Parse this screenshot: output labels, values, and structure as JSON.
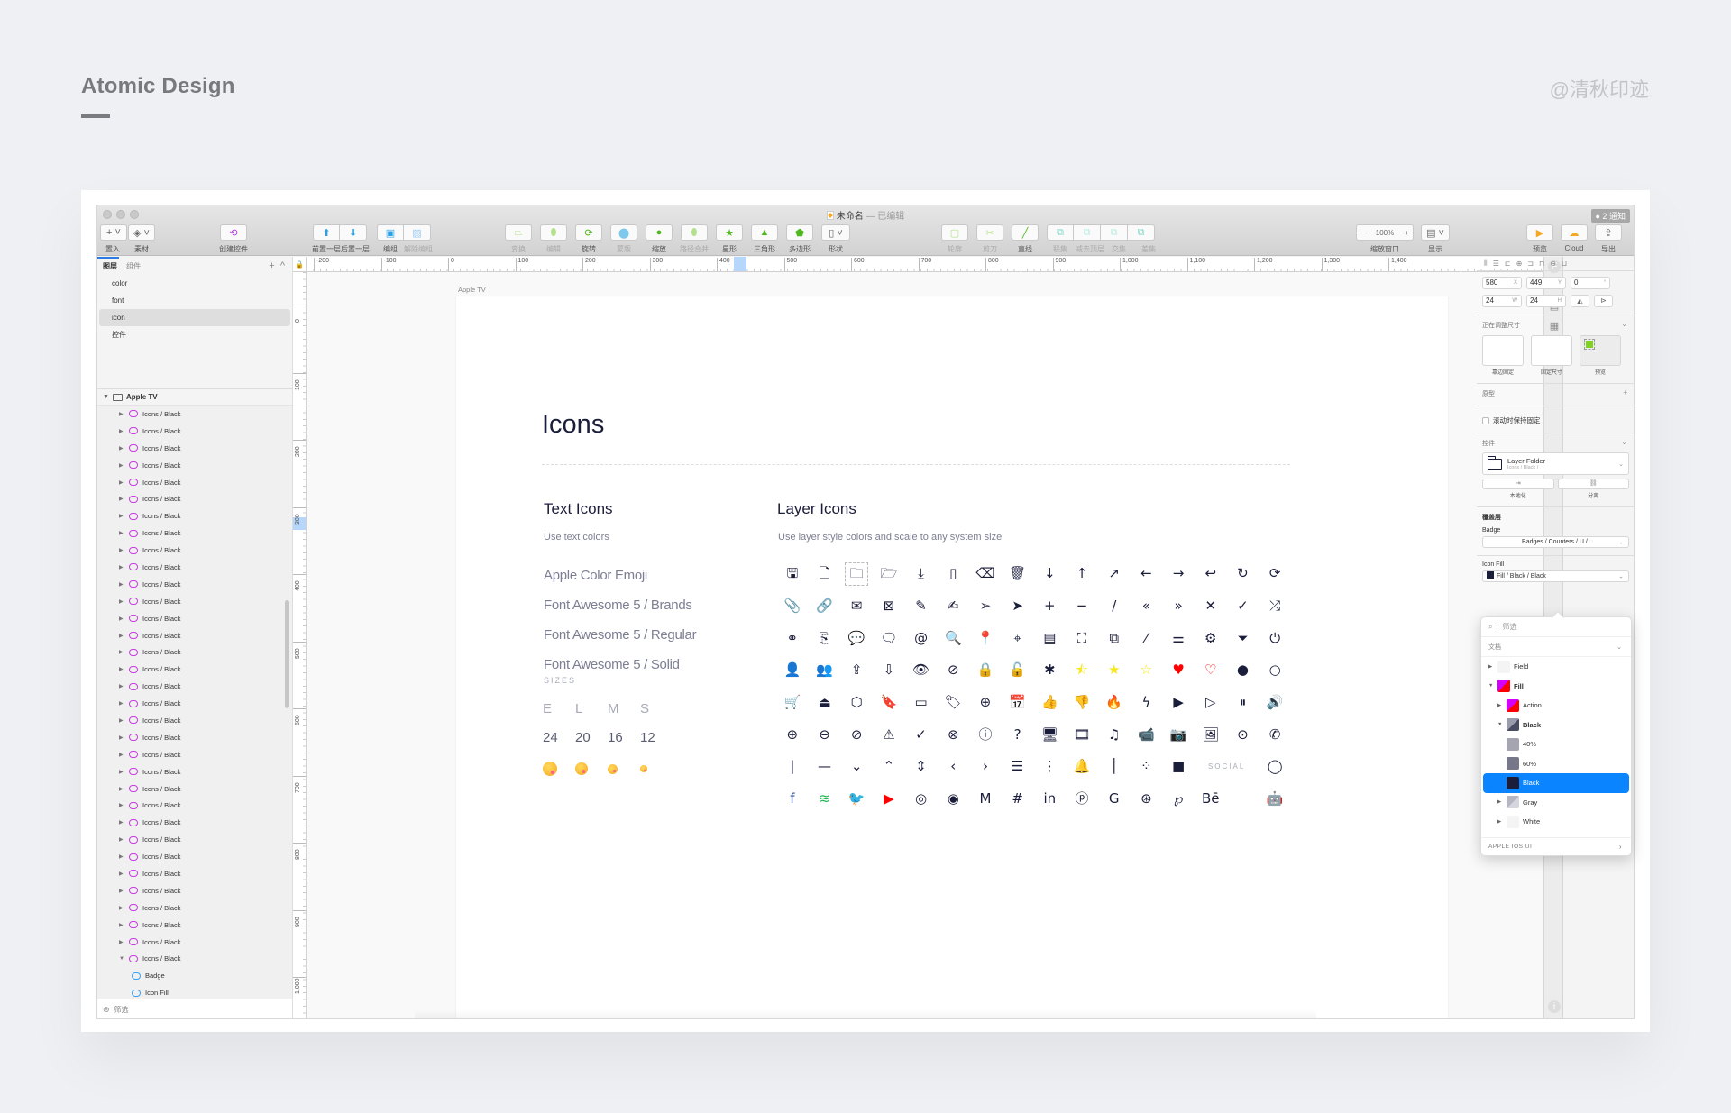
{
  "page": {
    "heading": "Atomic Design",
    "watermark": "@清秋印迹"
  },
  "window": {
    "title": "未命名",
    "title_status": "— 已编辑",
    "notification_badge": "● 2 通知"
  },
  "toolbar": {
    "insert": {
      "label": "置入",
      "icon": "plus-icon"
    },
    "assets": {
      "label": "素材",
      "icon": "layers-icon"
    },
    "create_symbol": {
      "label": "创建控件",
      "icon": "sync-icon"
    },
    "forward": {
      "label": "前置一层"
    },
    "backward": {
      "label": "后置一层"
    },
    "group": {
      "label": "编组"
    },
    "ungroup": {
      "label": "解除编组"
    },
    "transform": {
      "label": "变换"
    },
    "edit": {
      "label": "编辑"
    },
    "rotate": {
      "label": "旋转"
    },
    "mask": {
      "label": "蒙版"
    },
    "scale": {
      "label": "缩放"
    },
    "flatten": {
      "label": "路径合并"
    },
    "star": {
      "label": "星形"
    },
    "triangle": {
      "label": "三角形"
    },
    "polygon": {
      "label": "多边形"
    },
    "shape": {
      "label": "形状"
    },
    "outline": {
      "label": "轮廓"
    },
    "scissors": {
      "label": "剪刀"
    },
    "line": {
      "label": "直线"
    },
    "union": {
      "label": "联集"
    },
    "subtract": {
      "label": "减去顶层"
    },
    "intersect": {
      "label": "交集"
    },
    "difference": {
      "label": "差集"
    },
    "zoom": {
      "label": "缩放窗口",
      "value": "100%",
      "minus": "−",
      "plus": "+"
    },
    "view": {
      "label": "显示"
    },
    "preview": {
      "label": "预览"
    },
    "cloud": {
      "label": "Cloud"
    },
    "export": {
      "label": "导出"
    }
  },
  "left_panel": {
    "tabs": [
      "图层",
      "组件"
    ],
    "add_label": "+",
    "collapse_label": "^",
    "pages": [
      {
        "name": "color",
        "selected": false
      },
      {
        "name": "font",
        "selected": false
      },
      {
        "name": "icon",
        "selected": true
      },
      {
        "name": "控件",
        "selected": false
      }
    ],
    "artboard": "Apple TV",
    "layers": [
      "Icons / Black",
      "Icons / Black",
      "Icons / Black",
      "Icons / Black",
      "Icons / Black",
      "Icons / Black",
      "Icons / Black",
      "Icons / Black",
      "Icons / Black",
      "Icons / Black",
      "Icons / Black",
      "Icons / Black",
      "Icons / Black",
      "Icons / Black",
      "Icons / Black",
      "Icons / Black",
      "Icons / Black",
      "Icons / Black",
      "Icons / Black",
      "Icons / Black",
      "Icons / Black",
      "Icons / Black",
      "Icons / Black",
      "Icons / Black",
      "Icons / Black",
      "Icons / Black",
      "Icons / Black",
      "Icons / Black",
      "Icons / Black",
      "Icons / Black",
      "Icons / Black",
      "Icons / Black",
      "Icons / Black"
    ],
    "expanded_layer": "Icons / Black",
    "children": [
      "Badge",
      "Icon Fill"
    ],
    "selected_layer": "Icons / Black",
    "filter_label": "筛选"
  },
  "rulers": {
    "horizontal": [
      "-200",
      "-100",
      "0",
      "100",
      "200",
      "300",
      "400",
      "500",
      "600",
      "700",
      "800",
      "900",
      "1,000",
      "1,100",
      "1,200",
      "1,300",
      "1,400"
    ],
    "vertical": [
      "0",
      "100",
      "200",
      "300",
      "400",
      "500",
      "600",
      "700",
      "800",
      "900",
      "1,000"
    ]
  },
  "canvas": {
    "artboard_label": "Apple TV",
    "title": "Icons",
    "text_icons": {
      "title": "Text Icons",
      "subtitle": "Use text colors",
      "fonts": [
        "Apple Color Emoji",
        "Font Awesome 5 / Brands",
        "Font Awesome 5 / Regular",
        "Font Awesome 5 / Solid"
      ],
      "sizes_label": "SIZES",
      "size_letters": [
        "E",
        "L",
        "M",
        "S"
      ],
      "size_values": [
        "24",
        "20",
        "16",
        "12"
      ]
    },
    "layer_icons": {
      "title": "Layer Icons",
      "subtitle": "Use layer style colors and scale to any system size",
      "social_label": "SOCIAL",
      "icons": [
        {
          "name": "save",
          "glyph": "🖫"
        },
        {
          "name": "file",
          "glyph": "🗋"
        },
        {
          "name": "folder",
          "glyph": "🗀",
          "selected": true
        },
        {
          "name": "folder-open",
          "glyph": "🗁"
        },
        {
          "name": "download",
          "glyph": "⤓"
        },
        {
          "name": "file-zip",
          "glyph": "▯"
        },
        {
          "name": "backspace",
          "glyph": "⌫"
        },
        {
          "name": "trash",
          "glyph": "🗑"
        },
        {
          "name": "arrow-down",
          "glyph": "↓"
        },
        {
          "name": "arrow-up",
          "glyph": "↑"
        },
        {
          "name": "arrow-up-right",
          "glyph": "↗"
        },
        {
          "name": "arrow-left",
          "glyph": "←"
        },
        {
          "name": "arrow-right",
          "glyph": "→"
        },
        {
          "name": "undo",
          "glyph": "↩"
        },
        {
          "name": "redo",
          "glyph": "↻"
        },
        {
          "name": "sync",
          "glyph": "⟳"
        },
        {
          "name": "paperclip",
          "glyph": "📎"
        },
        {
          "name": "link",
          "glyph": "🔗"
        },
        {
          "name": "mail",
          "glyph": "✉"
        },
        {
          "name": "mail-open",
          "glyph": "⊠"
        },
        {
          "name": "pen",
          "glyph": "✎"
        },
        {
          "name": "edit",
          "glyph": "✍"
        },
        {
          "name": "send",
          "glyph": "➢"
        },
        {
          "name": "navigation",
          "glyph": "➤"
        },
        {
          "name": "plus",
          "glyph": "+"
        },
        {
          "name": "minus",
          "glyph": "−"
        },
        {
          "name": "slash",
          "glyph": "/"
        },
        {
          "name": "chevrons-left",
          "glyph": "«"
        },
        {
          "name": "chevrons-right",
          "glyph": "»"
        },
        {
          "name": "close",
          "glyph": "✕"
        },
        {
          "name": "check",
          "glyph": "✓"
        },
        {
          "name": "shuffle",
          "glyph": "⤮"
        },
        {
          "name": "link-alt",
          "glyph": "⚭"
        },
        {
          "name": "copy",
          "glyph": "⎘"
        },
        {
          "name": "comment",
          "glyph": "💬"
        },
        {
          "name": "comments",
          "glyph": "🗨"
        },
        {
          "name": "at",
          "glyph": "@"
        },
        {
          "name": "search",
          "glyph": "🔍"
        },
        {
          "name": "map-pin",
          "glyph": "📍"
        },
        {
          "name": "location",
          "glyph": "⌖"
        },
        {
          "name": "layout",
          "glyph": "▤"
        },
        {
          "name": "expand",
          "glyph": "⛶"
        },
        {
          "name": "external-link",
          "glyph": "⧉"
        },
        {
          "name": "resize-handle",
          "glyph": "⁄"
        },
        {
          "name": "sliders",
          "glyph": "⚌"
        },
        {
          "name": "settings",
          "glyph": "⚙"
        },
        {
          "name": "filter",
          "glyph": "⏷"
        },
        {
          "name": "power",
          "glyph": "⏻"
        },
        {
          "name": "user",
          "glyph": "👤"
        },
        {
          "name": "users",
          "glyph": "👥"
        },
        {
          "name": "cloud-upload",
          "glyph": "⇪"
        },
        {
          "name": "cloud-download",
          "glyph": "⇩"
        },
        {
          "name": "eye",
          "glyph": "👁"
        },
        {
          "name": "eye-off",
          "glyph": "⊘"
        },
        {
          "name": "lock",
          "glyph": "🔒"
        },
        {
          "name": "unlock",
          "glyph": "🔓"
        },
        {
          "name": "asterisk",
          "glyph": "✱"
        },
        {
          "name": "star-half",
          "glyph": "⯪",
          "color": "#f8e71c"
        },
        {
          "name": "star-filled",
          "glyph": "★",
          "color": "#f8e71c"
        },
        {
          "name": "star-outline",
          "glyph": "☆",
          "color": "#f8e71c"
        },
        {
          "name": "heart-filled",
          "glyph": "♥",
          "color": "#ff0000"
        },
        {
          "name": "heart-outline",
          "glyph": "♡",
          "color": "#ff0000"
        },
        {
          "name": "dot-filled",
          "glyph": "●"
        },
        {
          "name": "dot-outline",
          "glyph": "○"
        },
        {
          "name": "cart",
          "glyph": "🛒"
        },
        {
          "name": "basket",
          "glyph": "⏏"
        },
        {
          "name": "box",
          "glyph": "⬡"
        },
        {
          "name": "bookmark",
          "glyph": "🔖"
        },
        {
          "name": "credit-card",
          "glyph": "▭"
        },
        {
          "name": "tag",
          "glyph": "🏷"
        },
        {
          "name": "globe",
          "glyph": "⊕"
        },
        {
          "name": "calendar",
          "glyph": "📅"
        },
        {
          "name": "thumbs-up",
          "glyph": "👍"
        },
        {
          "name": "thumbs-down",
          "glyph": "👎"
        },
        {
          "name": "fire",
          "glyph": "🔥"
        },
        {
          "name": "bolt",
          "glyph": "ϟ"
        },
        {
          "name": "play-filled",
          "glyph": "▶"
        },
        {
          "name": "play-outline",
          "glyph": "▷"
        },
        {
          "name": "pause",
          "glyph": "⏸"
        },
        {
          "name": "volume",
          "glyph": "🔊"
        },
        {
          "name": "plus-circle",
          "glyph": "⊕"
        },
        {
          "name": "minus-circle",
          "glyph": "⊖"
        },
        {
          "name": "ban",
          "glyph": "⊘"
        },
        {
          "name": "warning",
          "glyph": "⚠"
        },
        {
          "name": "check-circle",
          "glyph": "✓"
        },
        {
          "name": "x-circle",
          "glyph": "⊗"
        },
        {
          "name": "info",
          "glyph": "ⓘ"
        },
        {
          "name": "help",
          "glyph": "?"
        },
        {
          "name": "monitor",
          "glyph": "🖥"
        },
        {
          "name": "film",
          "glyph": "🎞"
        },
        {
          "name": "music",
          "glyph": "♫"
        },
        {
          "name": "video",
          "glyph": "📹"
        },
        {
          "name": "camera",
          "glyph": "📷"
        },
        {
          "name": "image",
          "glyph": "🖼"
        },
        {
          "name": "compass",
          "glyph": "⊙"
        },
        {
          "name": "phone",
          "glyph": "✆"
        },
        {
          "name": "divider-vertical",
          "glyph": "|"
        },
        {
          "name": "divider-horizontal",
          "glyph": "—"
        },
        {
          "name": "chevron-down",
          "glyph": "⌄"
        },
        {
          "name": "chevron-up",
          "glyph": "⌃"
        },
        {
          "name": "chevron-up-down",
          "glyph": "⇕"
        },
        {
          "name": "chevron-left",
          "glyph": "‹"
        },
        {
          "name": "chevron-right",
          "glyph": "›"
        },
        {
          "name": "list",
          "glyph": "☰"
        },
        {
          "name": "more-vertical",
          "glyph": "⋮"
        },
        {
          "name": "bell",
          "glyph": "🔔"
        },
        {
          "name": "text-cursor",
          "glyph": "│"
        },
        {
          "name": "loader",
          "glyph": "⁘"
        },
        {
          "name": "square",
          "glyph": "■"
        },
        {
          "name": "social-label",
          "glyph": ""
        },
        {
          "name": "whatsapp",
          "glyph": "◯"
        },
        {
          "name": "facebook",
          "glyph": "f",
          "color": "#3b5998"
        },
        {
          "name": "spotify",
          "glyph": "≋",
          "color": "#1db954"
        },
        {
          "name": "twitter",
          "glyph": "🐦",
          "color": "#1da1f2"
        },
        {
          "name": "youtube",
          "glyph": "▶",
          "color": "#ff0000"
        },
        {
          "name": "instagram",
          "glyph": "◎"
        },
        {
          "name": "github",
          "glyph": "◉"
        },
        {
          "name": "medium",
          "glyph": "M"
        },
        {
          "name": "slack",
          "glyph": "#"
        },
        {
          "name": "linkedin",
          "glyph": "in"
        },
        {
          "name": "producthunt",
          "glyph": "ⓟ"
        },
        {
          "name": "google",
          "glyph": "G"
        },
        {
          "name": "dribbble",
          "glyph": "⊛"
        },
        {
          "name": "pinterest",
          "glyph": "℘"
        },
        {
          "name": "behance",
          "glyph": "Bē"
        },
        {
          "name": "apple",
          "glyph": ""
        },
        {
          "name": "android",
          "glyph": "🤖"
        }
      ]
    }
  },
  "inspector": {
    "x": "580",
    "x_unit": "X",
    "y": "449",
    "y_unit": "Y",
    "rotation": "0",
    "rotation_unit": "°",
    "w": "24",
    "w_unit": "W",
    "h": "24",
    "h_unit": "H",
    "resizing_label": "正在调整尺寸",
    "resize_options": [
      "靠边固定",
      "固定尺寸",
      "预览"
    ],
    "prototype_label": "原型",
    "fix_on_scroll_label": "滚动时保持固定",
    "symbol_label": "控件",
    "symbol_name": "Layer Folder",
    "symbol_path": "Icons / Black /",
    "detach_buttons": [
      "本地化",
      "分离"
    ],
    "overrides_label": "覆盖层",
    "badge_label": "Badge",
    "badge_value": "Badges / Counters / U /",
    "icon_fill_label": "Icon Fill",
    "icon_fill_value": "Fill / Black / Black",
    "icon_fill_color": "#1b1e3b"
  },
  "popover": {
    "search_placeholder": "筛选",
    "section": "文档",
    "items": [
      {
        "label": "Field",
        "level": 0,
        "tri": "▶"
      },
      {
        "label": "Fill",
        "level": 0,
        "tri": "▼",
        "bold": true
      },
      {
        "label": "Action",
        "level": 1,
        "tri": "▶"
      },
      {
        "label": "Black",
        "level": 1,
        "tri": "▼",
        "bold": true
      },
      {
        "label": "40%",
        "level": 2,
        "tri": "",
        "color": "#a4a5b0"
      },
      {
        "label": "60%",
        "level": 2,
        "tri": "",
        "color": "#767889"
      },
      {
        "label": "Black",
        "level": 2,
        "tri": "",
        "color": "#1b1e3b",
        "selected": true
      },
      {
        "label": "Gray",
        "level": 1,
        "tri": "▶"
      },
      {
        "label": "White",
        "level": 1,
        "tri": "▶"
      }
    ],
    "footer": "APPLE IOS UI"
  },
  "colors": {
    "accent": "#0a84ff",
    "symbol_purple": "#c63be0",
    "text_dark": "#1b1e3b",
    "text_muted": "#7c7f93"
  }
}
